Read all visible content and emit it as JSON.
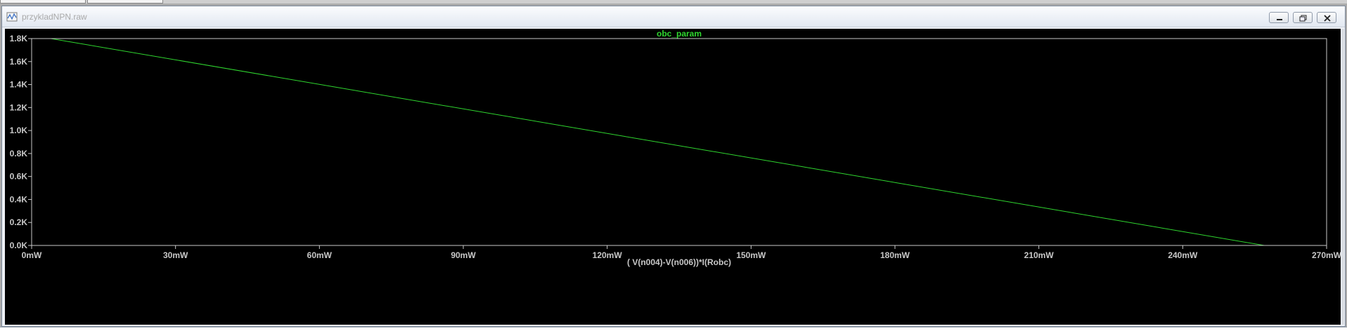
{
  "window": {
    "title": "przykladNPN.raw"
  },
  "colors": {
    "background": "#000000",
    "axis": "#c8c8c8",
    "label": "#c8c8c8",
    "trace": "#2fd62f"
  },
  "chart_data": {
    "type": "line",
    "title": "obc_param",
    "xlabel": "( V(n004)-V(n006))*I(Robc)",
    "ylabel": "",
    "x_unit": "mW",
    "y_unit": "K",
    "xlim": [
      0,
      270
    ],
    "ylim": [
      0,
      1.8
    ],
    "grid": false,
    "x_ticks": [
      0,
      30,
      60,
      90,
      120,
      150,
      180,
      210,
      240,
      270
    ],
    "x_tick_labels": [
      "0mW",
      "30mW",
      "60mW",
      "90mW",
      "120mW",
      "150mW",
      "180mW",
      "210mW",
      "240mW",
      "270mW"
    ],
    "y_ticks": [
      0,
      0.2,
      0.4,
      0.6,
      0.8,
      1.0,
      1.2,
      1.4,
      1.6,
      1.8
    ],
    "y_tick_labels": [
      "0.0K",
      "0.2K",
      "0.4K",
      "0.6K",
      "0.8K",
      "1.0K",
      "1.2K",
      "1.4K",
      "1.6K",
      "1.8K"
    ],
    "series": [
      {
        "x": [
          4,
          257
        ],
        "y": [
          1.8,
          0.0
        ]
      }
    ]
  }
}
